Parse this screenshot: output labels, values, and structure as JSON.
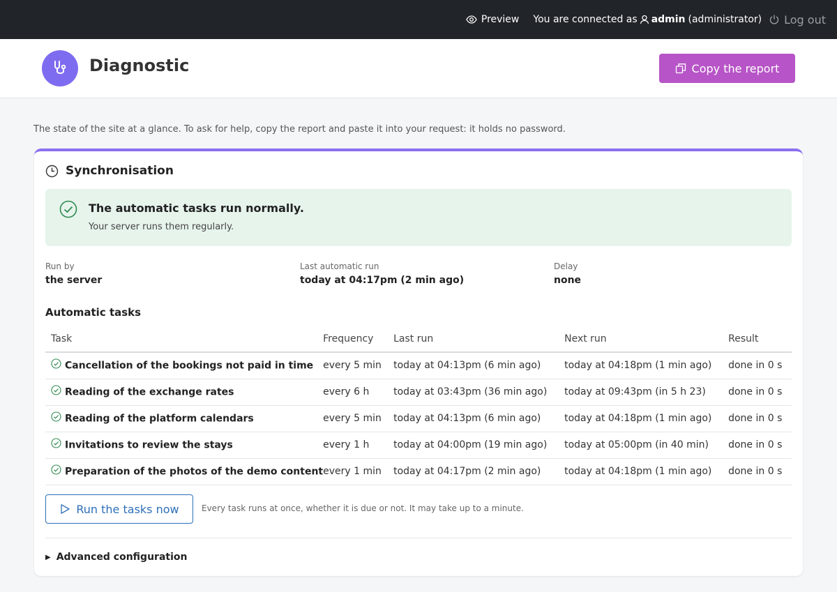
{
  "topbar": {
    "preview_label": "Preview",
    "connected_prefix": "You are connected as",
    "user_name": "admin",
    "user_role": "(administrator)",
    "logout_label": "Log out"
  },
  "header": {
    "title": "Diagnostic",
    "copy_button_label": "Copy the report"
  },
  "intro_text": "The state of the site at a glance. To ask for help, copy the report and paste it into your request: it holds no password.",
  "sync": {
    "title": "Synchronisation",
    "status_title": "The automatic tasks run normally.",
    "status_subtitle": "Your server runs them regularly.",
    "run_by_label": "Run by",
    "run_by_value": "the server",
    "last_run_label": "Last automatic run",
    "last_run_value": "today at 04:17pm (2 min ago)",
    "delay_label": "Delay",
    "delay_value": "none",
    "tasks_heading": "Automatic tasks",
    "columns": [
      "Task",
      "Frequency",
      "Last run",
      "Next run",
      "Result"
    ],
    "tasks": [
      {
        "name": "Cancellation of the bookings not paid in time",
        "frequency": "every 5 min",
        "last_run": "today at 04:13pm (6 min ago)",
        "next_run": "today at 04:18pm (1 min ago)",
        "result": "done in 0 s"
      },
      {
        "name": "Reading of the exchange rates",
        "frequency": "every 6 h",
        "last_run": "today at 03:43pm (36 min ago)",
        "next_run": "today at 09:43pm (in 5 h 23)",
        "result": "done in 0 s"
      },
      {
        "name": "Reading of the platform calendars",
        "frequency": "every 5 min",
        "last_run": "today at 04:13pm (6 min ago)",
        "next_run": "today at 04:18pm (1 min ago)",
        "result": "done in 0 s"
      },
      {
        "name": "Invitations to review the stays",
        "frequency": "every 1 h",
        "last_run": "today at 04:00pm (19 min ago)",
        "next_run": "today at 05:00pm (in 40 min)",
        "result": "done in 0 s"
      },
      {
        "name": "Preparation of the photos of the demo content",
        "frequency": "every 1 min",
        "last_run": "today at 04:17pm (2 min ago)",
        "next_run": "today at 04:18pm (1 min ago)",
        "result": "done in 0 s"
      }
    ],
    "run_button_label": "Run the tasks now",
    "run_note": "Every task runs at once, whether it is due or not. It may take up to a minute.",
    "advanced_label": "Advanced configuration"
  },
  "icons": {
    "preview": "eye-icon",
    "user": "user-icon",
    "logout": "power-icon",
    "logo": "stethoscope-icon",
    "copy": "copy-icon",
    "sync": "clock-icon",
    "status": "check-circle-icon",
    "run": "play-icon",
    "expand": "triangle-right-icon"
  },
  "colors": {
    "topbar_bg": "#212428",
    "accent_purple": "#7e6cf0",
    "copy_button": "#b754c7",
    "success_bg": "#e6f4ec",
    "success_green": "#2f8a4f",
    "run_button_blue": "#2d6fb8"
  }
}
